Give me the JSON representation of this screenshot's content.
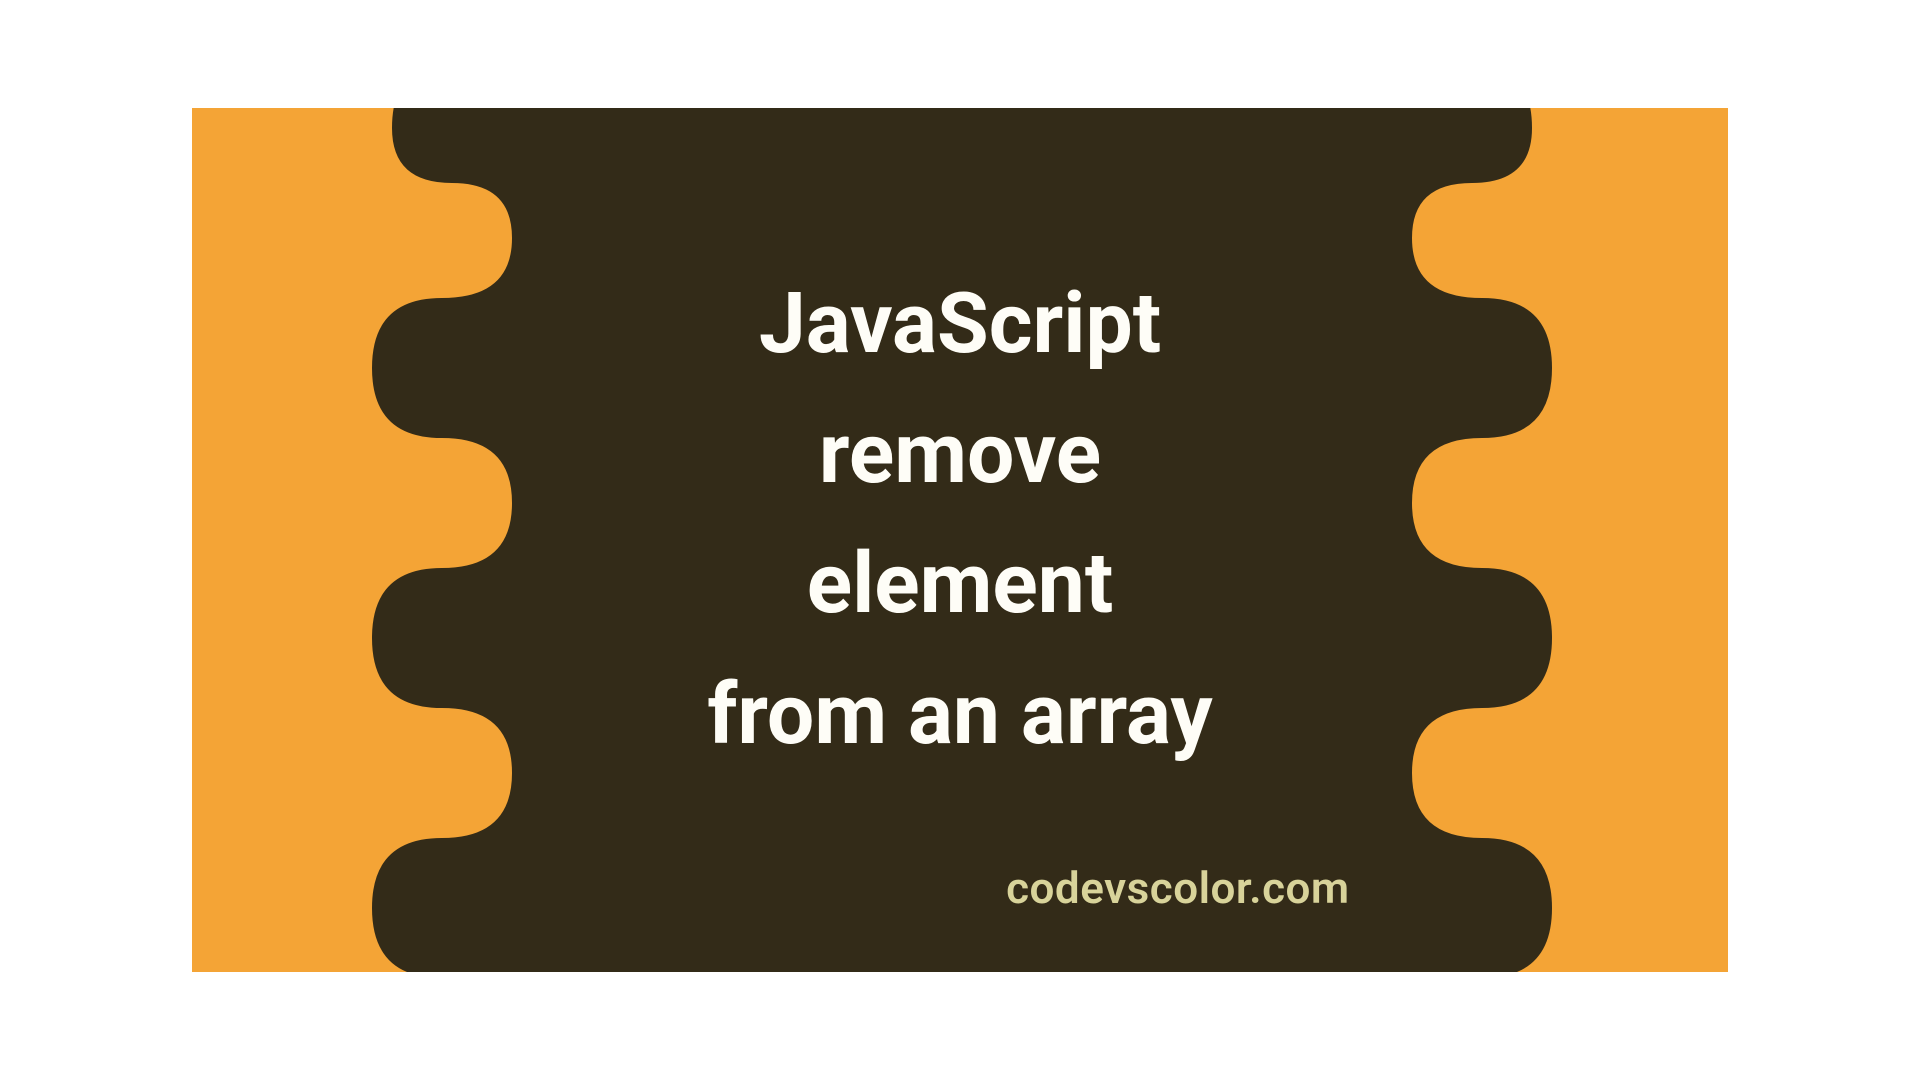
{
  "title_lines": [
    "JavaScript",
    "remove",
    "element",
    "from an array"
  ],
  "site": "codevscolor.com",
  "colors": {
    "background": "#f4a436",
    "blob": "#332b18",
    "title": "#fefdf7",
    "site": "#d8d39a"
  }
}
